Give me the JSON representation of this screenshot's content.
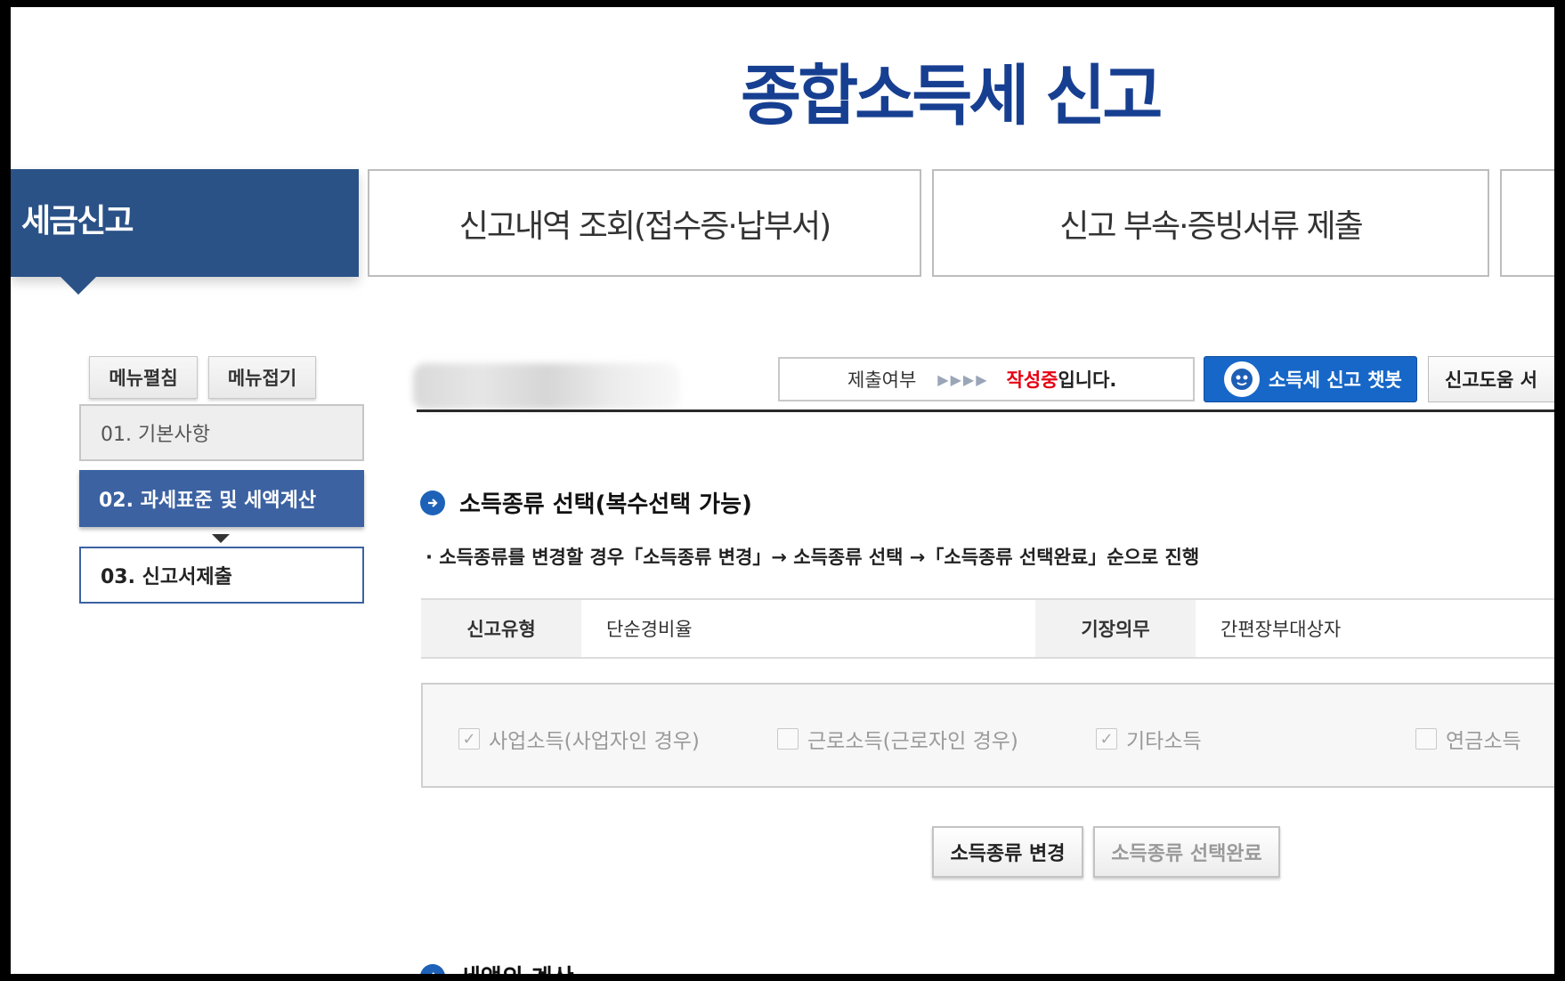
{
  "header": {
    "title": "종합소득세 신고"
  },
  "top_tabs": [
    {
      "label": "세금신고"
    },
    {
      "label": "신고내역 조회(접수증·납부서)"
    },
    {
      "label": "신고 부속·증빙서류 제출"
    }
  ],
  "sidebar": {
    "expand_label": "메뉴펼침",
    "collapse_label": "메뉴접기",
    "steps": [
      {
        "label": "01. 기본사항"
      },
      {
        "label": "02. 과세표준 및 세액계산"
      },
      {
        "label": "03. 신고서제출"
      }
    ]
  },
  "toolbar": {
    "submission_label": "제출여부",
    "arrows": "▶▶▶▶",
    "state_text": "작성중",
    "state_suffix": "입니다.",
    "chatbot_label": "소득세 신고 챗봇",
    "help_label": "신고도움 서"
  },
  "income_section": {
    "heading": "소득종류 선택(복수선택 가능)",
    "note": "· 소득종류를 변경할 경우「소득종류 변경」→ 소득종류 선택 →「소득종류 선택완료」순으로 진행",
    "info": {
      "report_type_label": "신고유형",
      "report_type_value": "단순경비율",
      "bookkeeping_label": "기장의무",
      "bookkeeping_value": "간편장부대상자"
    },
    "options": [
      {
        "label": "사업소득(사업자인 경우)",
        "checked": true
      },
      {
        "label": "근로소득(근로자인 경우)",
        "checked": false
      },
      {
        "label": "기타소득",
        "checked": true
      },
      {
        "label": "연금소득",
        "checked": false
      }
    ],
    "change_button": "소득종류 변경",
    "complete_button": "소득종류 선택완료"
  },
  "tax_section": {
    "heading": "세액의 계산"
  },
  "colors": {
    "title_blue": "#173f91",
    "tab_active": "#2b5287",
    "step_active": "#3c62a2",
    "chatbot_blue": "#1767c8",
    "state_red": "#e60012"
  }
}
